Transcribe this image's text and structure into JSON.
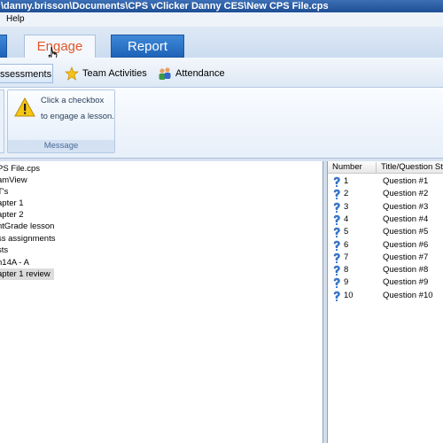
{
  "window": {
    "title": "\\danny.brisson\\Documents\\CPS vClicker Danny CES\\New CPS File.cps"
  },
  "menu": {
    "help": "Help"
  },
  "ribbon": {
    "tabs": {
      "engage": "Engage",
      "report": "Report"
    },
    "subtabs": {
      "assessments": "ssessments",
      "team": "Team Activities",
      "attendance": "Attendance"
    },
    "message": {
      "line1": "Click a checkbox",
      "line2": "to engage a lesson.",
      "caption": "Message"
    }
  },
  "tree": {
    "items": [
      "PS File.cps",
      "amView",
      "T's",
      "apter 1",
      "apter 2",
      "ntGrade lesson",
      "ss assignments",
      "sts",
      "n14A - A",
      "apter 1 review"
    ],
    "selected_index": 9
  },
  "questions": {
    "columns": {
      "number": "Number",
      "title": "Title/Question Ste"
    },
    "rows": [
      {
        "number": "1",
        "title": "Question #1"
      },
      {
        "number": "2",
        "title": "Question #2"
      },
      {
        "number": "3",
        "title": "Question #3"
      },
      {
        "number": "4",
        "title": "Question #4"
      },
      {
        "number": "5",
        "title": "Question #5"
      },
      {
        "number": "6",
        "title": "Question #6"
      },
      {
        "number": "7",
        "title": "Question #7"
      },
      {
        "number": "8",
        "title": "Question #8"
      },
      {
        "number": "9",
        "title": "Question #9"
      },
      {
        "number": "10",
        "title": "Question #10"
      }
    ],
    "icon": "question-mark-icon"
  },
  "colors": {
    "accent_tab": "#e2572a",
    "title_bar": "#1f4f95",
    "ribbon_tab_blue": "#1e63b8"
  }
}
